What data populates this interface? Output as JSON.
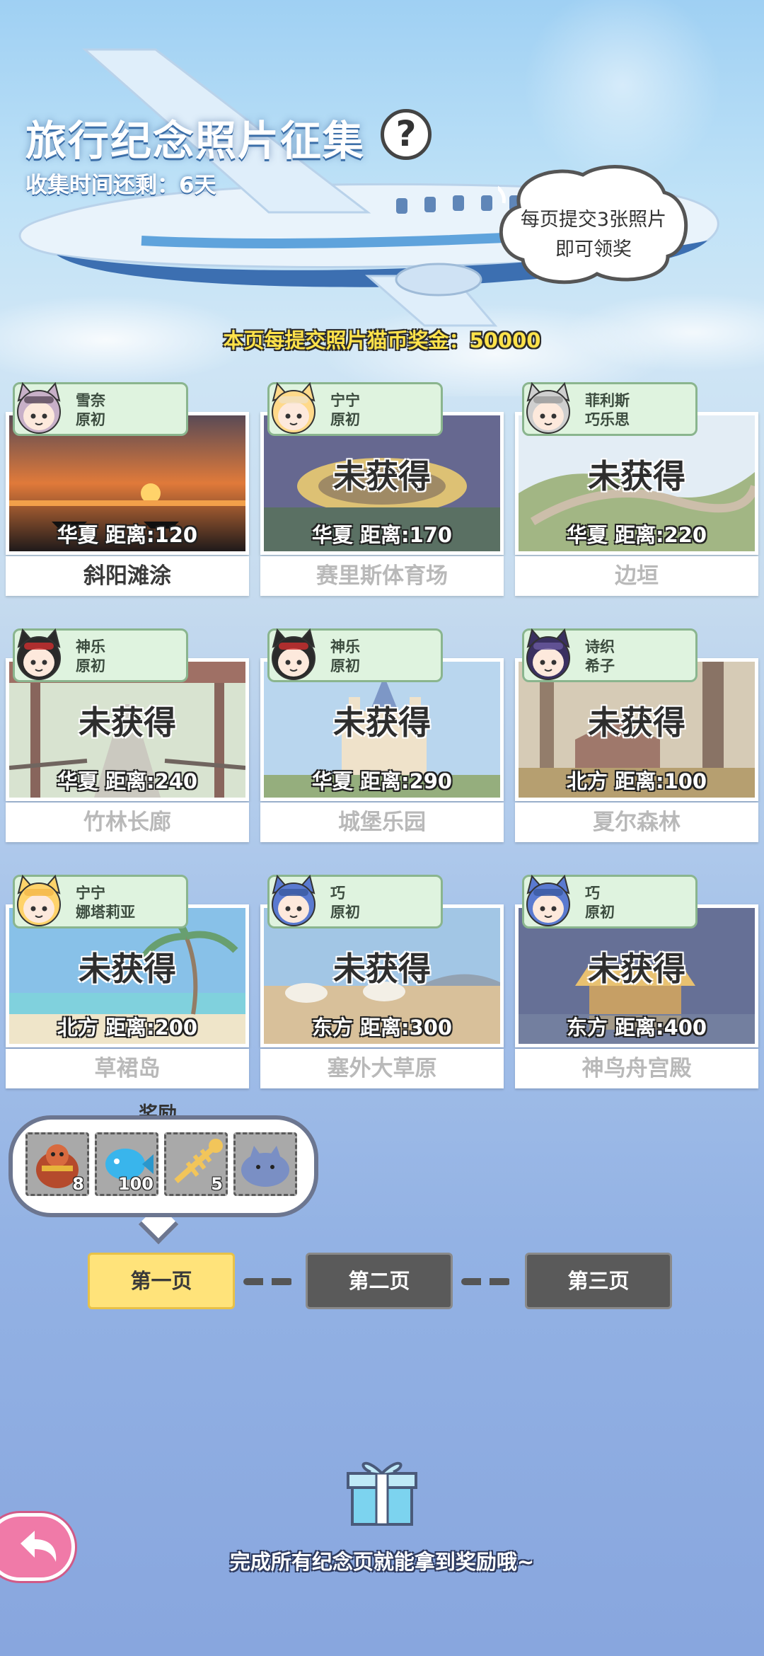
{
  "header": {
    "title": "旅行纪念照片征集",
    "help_label": "?",
    "countdown": "收集时间还剩：6天"
  },
  "bubble": {
    "line1": "每页提交3张照片",
    "line2": "即可领奖"
  },
  "bonus_text": "本页每提交照片猫币奖金：50000",
  "not_obtained_label": "未获得",
  "cards": [
    {
      "name": "斜阳滩涂",
      "distance": "华夏  距离:120",
      "char1": "雪奈",
      "char2": "原初",
      "obtained": true,
      "photo": "sunset-beach"
    },
    {
      "name": "赛里斯体育场",
      "distance": "华夏  距离:170",
      "char1": "宁宁",
      "char2": "原初",
      "obtained": false,
      "photo": "stadium-night"
    },
    {
      "name": "边垣",
      "distance": "华夏  距离:220",
      "char1": "菲利斯",
      "char2": "巧乐思",
      "obtained": false,
      "photo": "great-wall"
    },
    {
      "name": "竹林长廊",
      "distance": "华夏  距离:240",
      "char1": "神乐",
      "char2": "原初",
      "obtained": false,
      "photo": "corridor"
    },
    {
      "name": "城堡乐园",
      "distance": "华夏  距离:290",
      "char1": "神乐",
      "char2": "原初",
      "obtained": false,
      "photo": "castle"
    },
    {
      "name": "夏尔森林",
      "distance": "北方  距离:100",
      "char1": "诗织",
      "char2": "希子",
      "obtained": false,
      "photo": "forest"
    },
    {
      "name": "草裙岛",
      "distance": "北方  距离:200",
      "char1": "宁宁",
      "char2": "娜塔莉亚",
      "obtained": false,
      "photo": "island"
    },
    {
      "name": "塞外大草原",
      "distance": "东方  距离:300",
      "char1": "巧",
      "char2": "原初",
      "obtained": false,
      "photo": "grassland"
    },
    {
      "name": "神鸟舟宫殿",
      "distance": "东方  距离:400",
      "char1": "巧",
      "char2": "原初",
      "obtained": false,
      "photo": "palace"
    }
  ],
  "rewards": {
    "label": "奖励",
    "items": [
      {
        "icon": "fortune-cat-bag-icon",
        "count": "8"
      },
      {
        "icon": "blue-fish-icon",
        "count": "100"
      },
      {
        "icon": "fish-bone-icon",
        "count": "5"
      },
      {
        "icon": "cat-plush-icon",
        "count": ""
      }
    ]
  },
  "pages": [
    {
      "label": "第一页",
      "selected": true
    },
    {
      "label": "第二页",
      "selected": false
    },
    {
      "label": "第三页",
      "selected": false
    }
  ],
  "footer_text": "完成所有纪念页就能拿到奖励哦~",
  "colors": {
    "selected_page": "#ffe37a",
    "unselected_page": "#5a5a5a",
    "bonus_text": "#ffe24a",
    "tag_bg": "#dff3df",
    "back_button": "#f07aa8"
  }
}
